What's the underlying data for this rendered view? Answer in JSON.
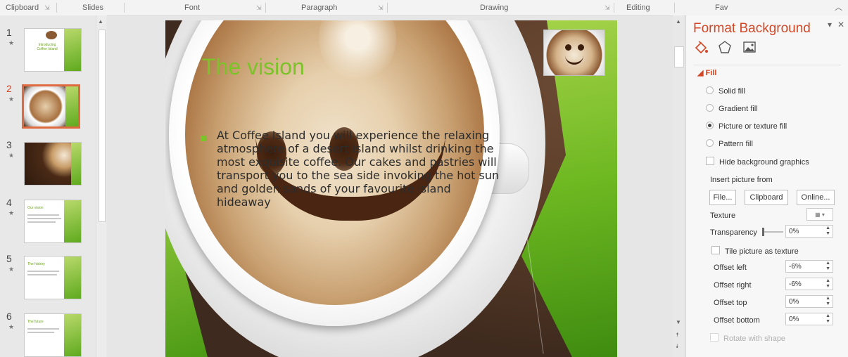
{
  "ribbon": {
    "groups": [
      "Clipboard",
      "Slides",
      "Font",
      "Paragraph",
      "Drawing",
      "Editing",
      "Fav"
    ]
  },
  "thumbnails": [
    {
      "num": "1",
      "star": "★",
      "title": "Introducing Coffee Island"
    },
    {
      "num": "2",
      "star": "★"
    },
    {
      "num": "3",
      "star": "★"
    },
    {
      "num": "4",
      "star": "★",
      "title": "Our vision"
    },
    {
      "num": "5",
      "star": "★",
      "title": "The history"
    },
    {
      "num": "6",
      "star": "★",
      "title": "The future"
    }
  ],
  "slide": {
    "title": "The vision",
    "body": "At Coffee Island you will experience the relaxing atmosphere of a desert island whilst drinking the most exquisite coffee. Our cakes and pastries will transport you to the sea side invoking the hot sun and golden sands of your favourite island hideaway"
  },
  "format_pane": {
    "title": "Format Background",
    "pin": "▾",
    "close": "✕",
    "section": "◢ Fill",
    "options": [
      "Solid fill",
      "Gradient fill",
      "Picture or texture fill",
      "Pattern fill"
    ],
    "selected_option": "Picture or texture fill",
    "hide_graphics": "Hide background graphics",
    "insert_from": "Insert picture from",
    "buttons": [
      "File...",
      "Clipboard",
      "Online..."
    ],
    "texture_label": "Texture",
    "transparency_label": "Transparency",
    "transparency_value": "0%",
    "tile_label": "Tile picture as texture",
    "offsets": [
      {
        "label": "Offset left",
        "value": "-6%"
      },
      {
        "label": "Offset right",
        "value": "-6%"
      },
      {
        "label": "Offset top",
        "value": "0%"
      },
      {
        "label": "Offset bottom",
        "value": "0%"
      }
    ],
    "rotate_label": "Rotate with shape"
  },
  "colors": {
    "accent": "#d24726",
    "slide_green": "#7cc32a"
  }
}
